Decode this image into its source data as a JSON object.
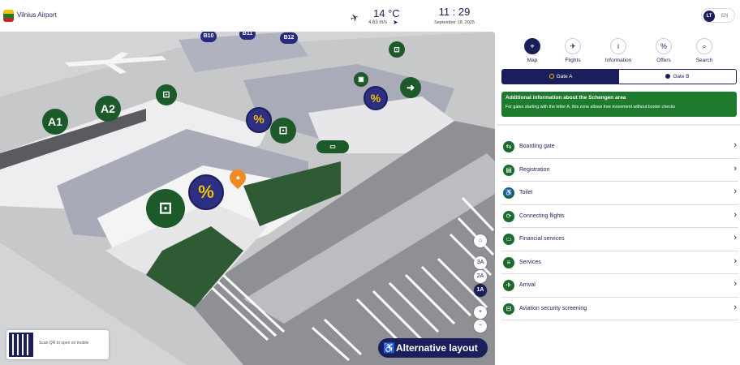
{
  "header": {
    "app_title": "Vilnius Airport",
    "temperature": "14 °C",
    "wind": "4.63 m/s",
    "time": "11 : 29",
    "date": "September 18, 2025",
    "lang_active": "LT",
    "lang_other": "EN"
  },
  "colors": {
    "navy": "#1a1f5c",
    "green": "#1e7a2c",
    "map_bg": "#d3d4d6"
  },
  "map": {
    "gate_labels": [
      "A1",
      "A2",
      "B10",
      "B11",
      "B12"
    ],
    "levels": [
      "3A",
      "2A",
      "1A"
    ],
    "active_level": "1A",
    "home_icon": "home-icon",
    "zoom_in": "+",
    "zoom_out": "−",
    "qr_text": "Scan QR to open on mobile",
    "alt_layout_label": "Alternative layout"
  },
  "nav": [
    {
      "label": "Map",
      "icon": "map-pin-icon",
      "glyph": "⌖"
    },
    {
      "label": "Flights",
      "icon": "plane-icon",
      "glyph": "✈"
    },
    {
      "label": "Information",
      "icon": "info-icon",
      "glyph": "i"
    },
    {
      "label": "Offers",
      "icon": "percent-icon",
      "glyph": "%"
    },
    {
      "label": "Search",
      "icon": "search-icon",
      "glyph": "⌕"
    }
  ],
  "gates": {
    "a": "Gate A",
    "b": "Gate B"
  },
  "schengen": {
    "title": "Additional information about the Schengen area",
    "text": "For gates starting with the letter A, this zone allows free movement without border checks"
  },
  "list": [
    {
      "label": "Boarding gate",
      "icon": "boarding-gate-icon",
      "glyph": "⇆"
    },
    {
      "label": "Registration",
      "icon": "registration-icon",
      "glyph": "▤"
    },
    {
      "label": "Toilet",
      "icon": "toilet-icon",
      "glyph": "♿"
    },
    {
      "label": "Connecting flights",
      "icon": "connecting-flights-icon",
      "glyph": "⟳"
    },
    {
      "label": "Financial services",
      "icon": "card-icon",
      "glyph": "▭"
    },
    {
      "label": "Services",
      "icon": "services-icon",
      "glyph": "≡"
    },
    {
      "label": "Arrival",
      "icon": "arrival-icon",
      "glyph": "✈"
    },
    {
      "label": "Aviation security screening",
      "icon": "security-icon",
      "glyph": "⊟"
    }
  ],
  "chevron": "›"
}
